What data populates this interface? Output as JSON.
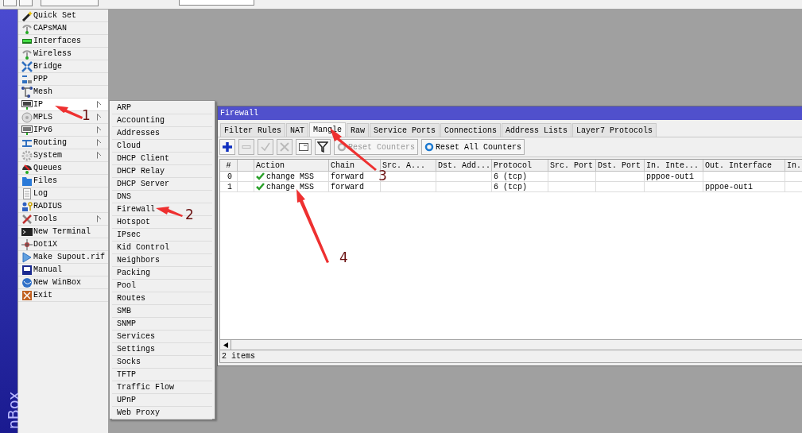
{
  "menu": [
    {
      "label": "Quick Set",
      "has_submenu": false,
      "selected": false
    },
    {
      "label": "CAPsMAN",
      "has_submenu": false,
      "selected": false
    },
    {
      "label": "Interfaces",
      "has_submenu": false,
      "selected": false
    },
    {
      "label": "Wireless",
      "has_submenu": false,
      "selected": false
    },
    {
      "label": "Bridge",
      "has_submenu": false,
      "selected": false
    },
    {
      "label": "PPP",
      "has_submenu": false,
      "selected": false
    },
    {
      "label": "Mesh",
      "has_submenu": false,
      "selected": false
    },
    {
      "label": "IP",
      "has_submenu": true,
      "selected": true
    },
    {
      "label": "MPLS",
      "has_submenu": true,
      "selected": false
    },
    {
      "label": "IPv6",
      "has_submenu": true,
      "selected": false
    },
    {
      "label": "Routing",
      "has_submenu": true,
      "selected": false
    },
    {
      "label": "System",
      "has_submenu": true,
      "selected": false
    },
    {
      "label": "Queues",
      "has_submenu": false,
      "selected": false
    },
    {
      "label": "Files",
      "has_submenu": false,
      "selected": false
    },
    {
      "label": "Log",
      "has_submenu": false,
      "selected": false
    },
    {
      "label": "RADIUS",
      "has_submenu": false,
      "selected": false
    },
    {
      "label": "Tools",
      "has_submenu": true,
      "selected": false
    },
    {
      "label": "New Terminal",
      "has_submenu": false,
      "selected": false
    },
    {
      "label": "Dot1X",
      "has_submenu": false,
      "selected": false
    },
    {
      "label": "Make Supout.rif",
      "has_submenu": false,
      "selected": false
    },
    {
      "label": "Manual",
      "has_submenu": false,
      "selected": false
    },
    {
      "label": "New WinBox",
      "has_submenu": false,
      "selected": false
    },
    {
      "label": "Exit",
      "has_submenu": false,
      "selected": false
    }
  ],
  "side_label": "nBox",
  "submenu": [
    "ARP",
    "Accounting",
    "Addresses",
    "Cloud",
    "DHCP Client",
    "DHCP Relay",
    "DHCP Server",
    "DNS",
    "Firewall",
    "Hotspot",
    "IPsec",
    "Kid Control",
    "Neighbors",
    "Packing",
    "Pool",
    "Routes",
    "SMB",
    "SNMP",
    "Services",
    "Settings",
    "Socks",
    "TFTP",
    "Traffic Flow",
    "UPnP",
    "Web Proxy"
  ],
  "window": {
    "title": "Firewall",
    "tabs": [
      {
        "label": "Filter Rules",
        "selected": false
      },
      {
        "label": "NAT",
        "selected": false
      },
      {
        "label": "Mangle",
        "selected": true
      },
      {
        "label": "Raw",
        "selected": false
      },
      {
        "label": "Service Ports",
        "selected": false
      },
      {
        "label": "Connections",
        "selected": false
      },
      {
        "label": "Address Lists",
        "selected": false
      },
      {
        "label": "Layer7 Protocols",
        "selected": false
      }
    ],
    "toolbar": [
      {
        "kind": "add",
        "disabled": false
      },
      {
        "kind": "remove",
        "disabled": true
      },
      {
        "kind": "enable",
        "disabled": true
      },
      {
        "kind": "disable",
        "disabled": true
      },
      {
        "kind": "comment",
        "disabled": false
      },
      {
        "kind": "filter",
        "disabled": false
      },
      {
        "kind": "reset",
        "label": "Reset Counters",
        "disabled": true
      },
      {
        "kind": "reset",
        "label": "Reset All Counters",
        "disabled": false
      }
    ],
    "table": {
      "columns": [
        "#",
        "",
        "Action",
        "Chain",
        "Src. A...",
        "Dst. Add...",
        "Protocol",
        "Src. Port",
        "Dst. Port",
        "In. Inte...",
        "Out. Interface",
        "In."
      ],
      "rows": [
        [
          "0",
          "",
          "change MSS",
          "forward",
          "",
          "",
          "6 (tcp)",
          "",
          "",
          "pppoe-out1",
          "",
          ""
        ],
        [
          "1",
          "",
          "change MSS",
          "forward",
          "",
          "",
          "6 (tcp)",
          "",
          "",
          "",
          "pppoe-out1",
          ""
        ]
      ]
    },
    "status": "2 items"
  },
  "annotations": [
    "1",
    "2",
    "3",
    "4"
  ]
}
